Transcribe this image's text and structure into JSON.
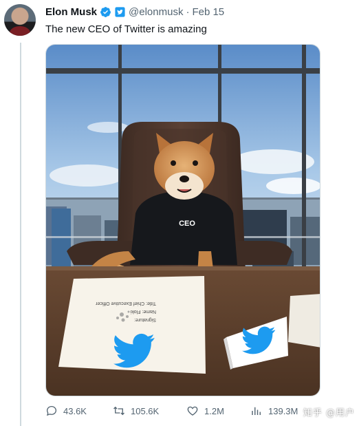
{
  "tweet": {
    "author_name": "Elon Musk",
    "handle": "@elonmusk",
    "separator": "·",
    "date": "Feb 15",
    "text": "The new CEO of Twitter is amazing",
    "verified_color": "#1d9bf0",
    "affiliate_badge_color": "#1d9bf0"
  },
  "media": {
    "sweater_text": "CEO",
    "paper_lines": [
      "Signature:",
      "Name:  Floki",
      "Title:  Chief Executive Officer"
    ],
    "icon": "twitter-bird"
  },
  "actions": {
    "replies": "43.6K",
    "retweets": "105.6K",
    "likes": "1.2M",
    "views": "139.3M"
  },
  "watermark": "知乎 @用户"
}
